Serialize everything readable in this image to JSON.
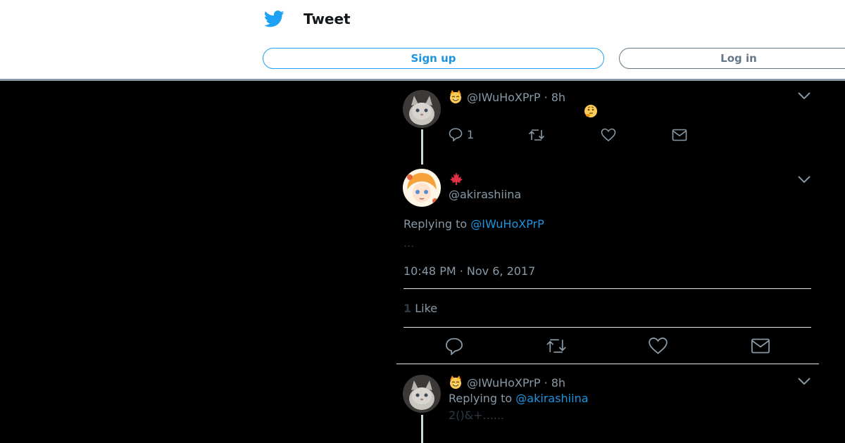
{
  "header": {
    "title": "Tweet",
    "signup_label": "Sign up",
    "login_label": "Log in"
  },
  "tweet1": {
    "handle": "@IWuHoXPrP",
    "time": "· 8h",
    "reply_count": "1"
  },
  "main_tweet": {
    "handle": "@akirashiina",
    "replying_prefix": "Replying to",
    "replying_to": "@IWuHoXPrP",
    "text": "...",
    "timestamp": "10:48 PM · Nov 6, 2017",
    "like_count": "1",
    "like_label": "Like"
  },
  "tweet2": {
    "handle": "@IWuHoXPrP",
    "time": "· 8h",
    "replying_prefix": "Replying to",
    "replying_to": "@akirashiina",
    "text": "2()&+......"
  },
  "colors": {
    "accent": "#1da1f2",
    "link": "#1b95e0",
    "muted": "#8899a6",
    "background": "#000000"
  }
}
